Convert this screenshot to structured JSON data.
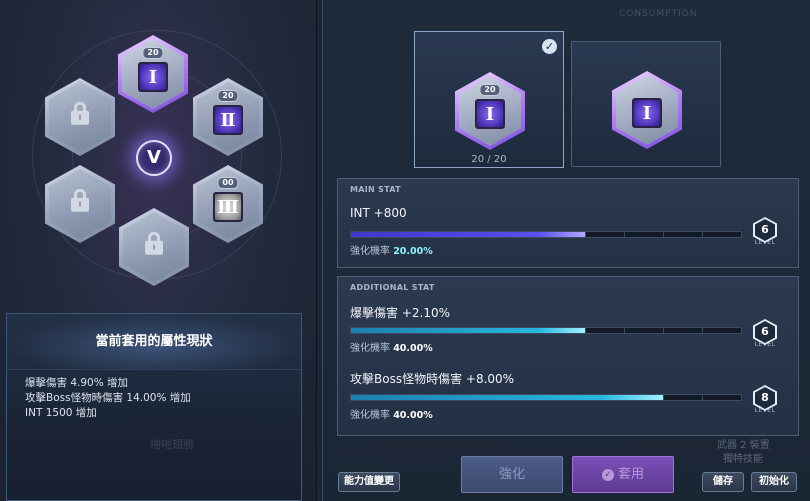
{
  "left": {
    "nodes": [
      {
        "id": "node-top",
        "level": "20",
        "glyph": "Ⅰ"
      },
      {
        "id": "node-right-upper",
        "level": "20",
        "glyph": "Ⅱ"
      },
      {
        "id": "node-right-lower",
        "level": "00",
        "glyph": "Ⅲ"
      }
    ],
    "core_label": "V",
    "status": {
      "title": "當前套用的屬性現狀",
      "lines": [
        "爆擊傷害 4.90% 增加",
        "攻擊Boss怪物時傷害 14.00% 增加",
        "INT 1500 增加"
      ]
    },
    "ghost_text": "啪啪翅膀"
  },
  "right": {
    "ghost_top": "CONSUMPTION",
    "cards": [
      {
        "level": "20",
        "glyph": "Ⅰ",
        "count": "20 / 20",
        "check": "✓"
      },
      {
        "level": "",
        "glyph": "Ⅰ",
        "count": ""
      }
    ],
    "main_stat": {
      "title": "MAIN STAT",
      "name": "INT +800",
      "rate_label": "強化機率",
      "rate_value": "20.00%",
      "fill_percent": 60,
      "level": "6",
      "level_label": "LEVEL"
    },
    "additional_stat": {
      "title": "ADDITIONAL STAT",
      "items": [
        {
          "name": "爆擊傷害 +2.10%",
          "rate_label": "強化機率",
          "rate_value": "40.00%",
          "fill_percent": 60,
          "level": "6",
          "level_label": "LEVEL"
        },
        {
          "name": "攻擊Boss怪物時傷害 +8.00%",
          "rate_label": "強化機率",
          "rate_value": "40.00%",
          "fill_percent": 80,
          "level": "8",
          "level_label": "LEVEL"
        }
      ]
    },
    "buttons": {
      "change": "能力值變更",
      "enhance": "強化",
      "apply": "套用",
      "save": "儲存",
      "reset": "初始化"
    },
    "ghost_right": [
      "武器 2 裝置",
      "獨特技能"
    ]
  },
  "colors": {
    "accent_purple": "#5a4ff0",
    "accent_cyan": "#28b8de",
    "rate_highlight": "#8df3ff"
  }
}
